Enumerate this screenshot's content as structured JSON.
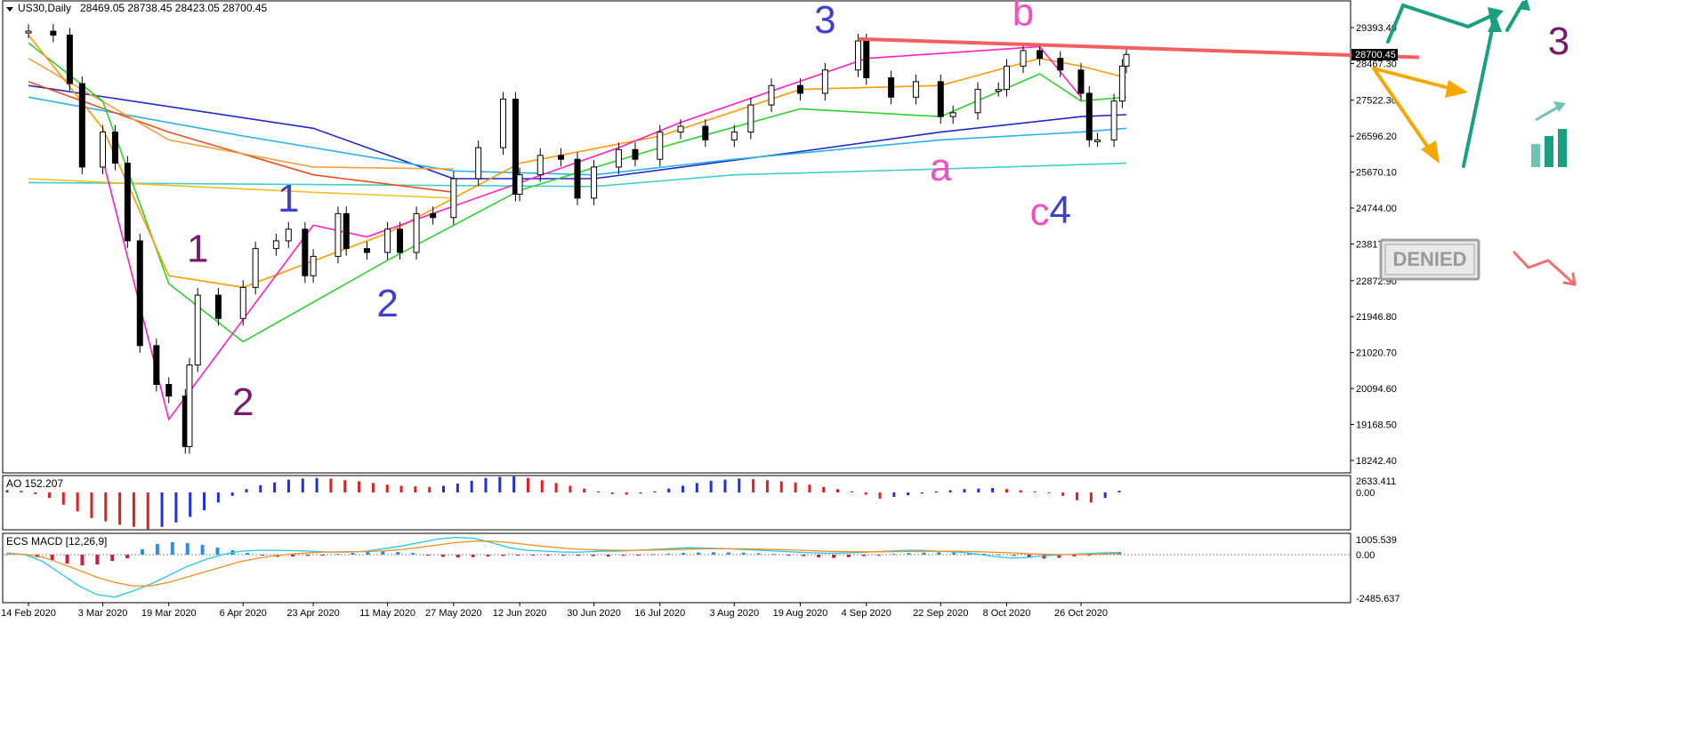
{
  "header": {
    "symbol": "US30,Daily",
    "ohlc": "28469.05 28738.45 28423.05 28700.45",
    "last_price": "28700.45"
  },
  "indicators": {
    "ao_label": "AO 152.207",
    "macd_label": "ECS MACD [12,26,9]"
  },
  "badge": {
    "text": "DENIED"
  },
  "chart_data": [
    {
      "type": "line",
      "panel": "price",
      "x_labels": [
        "14 Feb 2020",
        "3 Mar 2020",
        "19 Mar 2020",
        "6 Apr 2020",
        "23 Apr 2020",
        "11 May 2020",
        "27 May 2020",
        "12 Jun 2020",
        "30 Jun 2020",
        "16 Jul 2020",
        "3 Aug 2020",
        "19 Aug 2020",
        "4 Sep 2020",
        "22 Sep 2020",
        "8 Oct 2020",
        "26 Oct 2020"
      ],
      "y_ticks": [
        "29393.40",
        "28467.30",
        "27522.30",
        "26596.20",
        "25670.10",
        "24744.00",
        "23817.90",
        "22872.90",
        "21946.80",
        "21020.70",
        "20094.60",
        "19168.50",
        "18242.40"
      ],
      "ylim": [
        17900,
        29750
      ],
      "close_series": [
        {
          "date": "14 Feb 2020",
          "close": 29300
        },
        {
          "date": "20 Feb 2020",
          "close": 29200
        },
        {
          "date": "24 Feb 2020",
          "close": 27950
        },
        {
          "date": "27 Feb 2020",
          "close": 25800
        },
        {
          "date": "3 Mar 2020",
          "close": 26700
        },
        {
          "date": "6 Mar 2020",
          "close": 25900
        },
        {
          "date": "9 Mar 2020",
          "close": 23900
        },
        {
          "date": "12 Mar 2020",
          "close": 21200
        },
        {
          "date": "16 Mar 2020",
          "close": 20200
        },
        {
          "date": "19 Mar 2020",
          "close": 19900
        },
        {
          "date": "23 Mar 2020",
          "close": 18600
        },
        {
          "date": "24 Mar 2020",
          "close": 20700
        },
        {
          "date": "26 Mar 2020",
          "close": 22500
        },
        {
          "date": "31 Mar 2020",
          "close": 21900
        },
        {
          "date": "6 Apr 2020",
          "close": 22700
        },
        {
          "date": "9 Apr 2020",
          "close": 23700
        },
        {
          "date": "14 Apr 2020",
          "close": 23900
        },
        {
          "date": "17 Apr 2020",
          "close": 24200
        },
        {
          "date": "21 Apr 2020",
          "close": 23000
        },
        {
          "date": "23 Apr 2020",
          "close": 23500
        },
        {
          "date": "29 Apr 2020",
          "close": 24600
        },
        {
          "date": "1 May 2020",
          "close": 23700
        },
        {
          "date": "6 May 2020",
          "close": 23600
        },
        {
          "date": "11 May 2020",
          "close": 24200
        },
        {
          "date": "14 May 2020",
          "close": 23600
        },
        {
          "date": "18 May 2020",
          "close": 24600
        },
        {
          "date": "22 May 2020",
          "close": 24500
        },
        {
          "date": "27 May 2020",
          "close": 25500
        },
        {
          "date": "2 Jun 2020",
          "close": 26300
        },
        {
          "date": "8 Jun 2020",
          "close": 27550
        },
        {
          "date": "11 Jun 2020",
          "close": 25100
        },
        {
          "date": "12 Jun 2020",
          "close": 25600
        },
        {
          "date": "17 Jun 2020",
          "close": 26100
        },
        {
          "date": "22 Jun 2020",
          "close": 26000
        },
        {
          "date": "26 Jun 2020",
          "close": 25000
        },
        {
          "date": "30 Jun 2020",
          "close": 25800
        },
        {
          "date": "6 Jul 2020",
          "close": 26250
        },
        {
          "date": "10 Jul 2020",
          "close": 26000
        },
        {
          "date": "16 Jul 2020",
          "close": 26700
        },
        {
          "date": "21 Jul 2020",
          "close": 26850
        },
        {
          "date": "27 Jul 2020",
          "close": 26500
        },
        {
          "date": "3 Aug 2020",
          "close": 26700
        },
        {
          "date": "7 Aug 2020",
          "close": 27400
        },
        {
          "date": "12 Aug 2020",
          "close": 27900
        },
        {
          "date": "19 Aug 2020",
          "close": 27700
        },
        {
          "date": "25 Aug 2020",
          "close": 28300
        },
        {
          "date": "2 Sep 2020",
          "close": 29050
        },
        {
          "date": "4 Sep 2020",
          "close": 28100
        },
        {
          "date": "10 Sep 2020",
          "close": 27600
        },
        {
          "date": "16 Sep 2020",
          "close": 28000
        },
        {
          "date": "22 Sep 2020",
          "close": 27100
        },
        {
          "date": "25 Sep 2020",
          "close": 27200
        },
        {
          "date": "1 Oct 2020",
          "close": 27800
        },
        {
          "date": "6 Oct 2020",
          "close": 27800
        },
        {
          "date": "8 Oct 2020",
          "close": 28400
        },
        {
          "date": "12 Oct 2020",
          "close": 28800
        },
        {
          "date": "16 Oct 2020",
          "close": 28600
        },
        {
          "date": "21 Oct 2020",
          "close": 28300
        },
        {
          "date": "26 Oct 2020",
          "close": 27700
        },
        {
          "date": "28 Oct 2020",
          "close": 26500
        },
        {
          "date": "30 Oct 2020",
          "close": 26500
        },
        {
          "date": "3 Nov 2020",
          "close": 27500
        },
        {
          "date": "5 Nov 2020",
          "close": 28400
        },
        {
          "date": "6 Nov 2020",
          "close": 28700
        }
      ],
      "moving_averages": [
        {
          "color": "#2028c8",
          "points": [
            {
              "date": "14 Feb 2020",
              "value": 27900
            },
            {
              "date": "23 Apr 2020",
              "value": 26800
            },
            {
              "date": "27 May 2020",
              "value": 25500
            },
            {
              "date": "30 Jun 2020",
              "value": 25500
            },
            {
              "date": "19 Aug 2020",
              "value": 26200
            },
            {
              "date": "22 Sep 2020",
              "value": 26700
            },
            {
              "date": "26 Oct 2020",
              "value": 27100
            },
            {
              "date": "6 Nov 2020",
              "value": 27150
            }
          ]
        },
        {
          "color": "#28b4e8",
          "points": [
            {
              "date": "14 Feb 2020",
              "value": 27600
            },
            {
              "date": "6 Apr 2020",
              "value": 26600
            },
            {
              "date": "27 May 2020",
              "value": 25700
            },
            {
              "date": "30 Jun 2020",
              "value": 25600
            },
            {
              "date": "3 Aug 2020",
              "value": 26000
            },
            {
              "date": "22 Sep 2020",
              "value": 26500
            },
            {
              "date": "26 Oct 2020",
              "value": 26700
            },
            {
              "date": "6 Nov 2020",
              "value": 26800
            }
          ]
        },
        {
          "color": "#40d0c8",
          "points": [
            {
              "date": "14 Feb 2020",
              "value": 25400
            },
            {
              "date": "23 Apr 2020",
              "value": 25350
            },
            {
              "date": "30 Jun 2020",
              "value": 25300
            },
            {
              "date": "3 Aug 2020",
              "value": 25600
            },
            {
              "date": "22 Sep 2020",
              "value": 25750
            },
            {
              "date": "6 Nov 2020",
              "value": 25900
            }
          ]
        },
        {
          "color": "#e85020",
          "points": [
            {
              "date": "14 Feb 2020",
              "value": 28000
            },
            {
              "date": "19 Mar 2020",
              "value": 26700
            },
            {
              "date": "23 Apr 2020",
              "value": 25600
            },
            {
              "date": "27 May 2020",
              "value": 25150
            }
          ]
        },
        {
          "color": "#f0a040",
          "points": [
            {
              "date": "14 Feb 2020",
              "value": 28600
            },
            {
              "date": "19 Mar 2020",
              "value": 26500
            },
            {
              "date": "23 Apr 2020",
              "value": 25800
            },
            {
              "date": "27 May 2020",
              "value": 25750
            }
          ]
        },
        {
          "color": "#f0c020",
          "points": [
            {
              "date": "14 Feb 2020",
              "value": 25500
            },
            {
              "date": "23 Apr 2020",
              "value": 25150
            },
            {
              "date": "27 May 2020",
              "value": 25000
            }
          ]
        },
        {
          "color": "#30d030",
          "points": [
            {
              "date": "14 Feb 2020",
              "value": 29000
            },
            {
              "date": "3 Mar 2020",
              "value": 27500
            },
            {
              "date": "19 Mar 2020",
              "value": 22800
            },
            {
              "date": "6 Apr 2020",
              "value": 21300
            },
            {
              "date": "11 May 2020",
              "value": 23400
            },
            {
              "date": "12 Jun 2020",
              "value": 25200
            },
            {
              "date": "16 Jul 2020",
              "value": 26300
            },
            {
              "date": "19 Aug 2020",
              "value": 27300
            },
            {
              "date": "22 Sep 2020",
              "value": 27100
            },
            {
              "date": "16 Oct 2020",
              "value": 28200
            },
            {
              "date": "26 Oct 2020",
              "value": 27500
            },
            {
              "date": "6 Nov 2020",
              "value": 27600
            }
          ]
        },
        {
          "color": "#ff9a00",
          "points": [
            {
              "date": "14 Feb 2020",
              "value": 29200
            },
            {
              "date": "3 Mar 2020",
              "value": 26800
            },
            {
              "date": "19 Mar 2020",
              "value": 23000
            },
            {
              "date": "6 Apr 2020",
              "value": 22700
            },
            {
              "date": "11 May 2020",
              "value": 24100
            },
            {
              "date": "12 Jun 2020",
              "value": 25900
            },
            {
              "date": "16 Jul 2020",
              "value": 26600
            },
            {
              "date": "19 Aug 2020",
              "value": 27800
            },
            {
              "date": "22 Sep 2020",
              "value": 27900
            },
            {
              "date": "16 Oct 2020",
              "value": 28600
            },
            {
              "date": "26 Oct 2020",
              "value": 28400
            },
            {
              "date": "6 Nov 2020",
              "value": 28100
            }
          ]
        },
        {
          "color": "#ff20c0",
          "points": [
            {
              "date": "3 Mar 2020",
              "value": 26000
            },
            {
              "date": "19 Mar 2020",
              "value": 19300
            },
            {
              "date": "23 Apr 2020",
              "value": 24300
            },
            {
              "date": "6 May 2020",
              "value": 24000
            },
            {
              "date": "6 Jul 2020",
              "value": 26300
            },
            {
              "date": "21 Jul 2020",
              "value": 26950
            },
            {
              "date": "4 Sep 2020",
              "value": 28600
            },
            {
              "date": "16 Oct 2020",
              "value": 28900
            },
            {
              "date": "26 Oct 2020",
              "value": 27600
            }
          ]
        }
      ],
      "resistance_line": {
        "color": "#f06060",
        "from": {
          "date": "2 Sep 2020",
          "value": 29100
        },
        "to_value": 28900
      },
      "annotations": [
        {
          "text": "1",
          "color": "#7a1a6e",
          "date": "26 Mar 2020",
          "value": 23700
        },
        {
          "text": "2",
          "color": "#7a1a6e",
          "date": "6 Apr 2020",
          "value": 19750
        },
        {
          "text": "1",
          "color": "#4040d0",
          "date": "17 Apr 2020",
          "value": 25000
        },
        {
          "text": "2",
          "color": "#4040d0",
          "date": "11 May 2020",
          "value": 22300
        },
        {
          "text": "3",
          "color": "#4040d0",
          "date": "25 Aug 2020",
          "value": 29600
        },
        {
          "text": "a",
          "color": "#f050c0",
          "date": "22 Sep 2020",
          "value": 25800
        },
        {
          "text": "b",
          "color": "#f050c0",
          "date": "12 Oct 2020",
          "value": 29800
        },
        {
          "text": "c",
          "color": "#f050c0",
          "date": "16 Oct 2020",
          "value": 24650
        },
        {
          "text": "4",
          "color": "#4040d0",
          "date": "21 Oct 2020",
          "value": 24700
        },
        {
          "text": "3",
          "color": "#7a1a6e",
          "date": "future",
          "value": 29050
        }
      ]
    },
    {
      "type": "bar",
      "panel": "AO",
      "title": "AO 152.207",
      "y_ticks": [
        "2633.411",
        "0.00"
      ],
      "values": [
        200,
        150,
        -150,
        -500,
        -1100,
        -1700,
        -2300,
        -2600,
        -2900,
        -3100,
        -3300,
        -3100,
        -2700,
        -2200,
        -1600,
        -900,
        -300,
        300,
        650,
        900,
        1150,
        1250,
        1300,
        1250,
        1100,
        1000,
        850,
        700,
        600,
        550,
        500,
        600,
        800,
        1050,
        1300,
        1400,
        1450,
        1300,
        1100,
        850,
        600,
        350,
        100,
        -150,
        -200,
        -100,
        100,
        350,
        600,
        850,
        1050,
        1150,
        1250,
        1200,
        1100,
        1000,
        900,
        700,
        500,
        300,
        100,
        -200,
        -550,
        -400,
        -250,
        -100,
        100,
        200,
        300,
        350,
        400,
        300,
        200,
        100,
        -50,
        -300,
        -700,
        -900,
        -500,
        152
      ]
    },
    {
      "type": "bar",
      "panel": "MACD",
      "title": "ECS MACD [12,26,9]",
      "y_ticks": [
        "1005.539",
        "0.00",
        "-2485.637"
      ],
      "histogram": [
        30,
        40,
        -150,
        -300,
        -500,
        -600,
        -550,
        -350,
        -200,
        300,
        600,
        700,
        650,
        550,
        400,
        250,
        100,
        -50,
        -120,
        -100,
        -60,
        -20,
        40,
        100,
        150,
        180,
        150,
        100,
        -50,
        -120,
        -160,
        -140,
        -100,
        -70,
        -50,
        -30,
        -20,
        -40,
        -60,
        -80,
        -100,
        -60,
        -20,
        30,
        60,
        100,
        120,
        140,
        130,
        110,
        80,
        40,
        -20,
        -80,
        -150,
        -180,
        -140,
        -80,
        -20,
        40,
        90,
        120,
        140,
        120,
        90,
        50,
        10,
        -60,
        -150,
        -220,
        -180,
        -100,
        -40,
        120,
        152
      ],
      "macd": [
        100,
        0,
        -400,
        -1100,
        -1800,
        -2300,
        -2450,
        -2100,
        -1700,
        -1200,
        -700,
        -300,
        0,
        200,
        250,
        250,
        230,
        200,
        150,
        150,
        200,
        350,
        500,
        700,
        900,
        1000,
        950,
        700,
        400,
        250,
        200,
        150,
        150,
        200,
        200,
        250,
        300,
        350,
        400,
        380,
        350,
        300,
        250,
        200,
        150,
        100,
        80,
        100,
        150,
        200,
        250,
        250,
        200,
        150,
        50,
        -100,
        -200,
        -150,
        -50,
        0,
        50,
        100,
        120
      ],
      "signal": [
        50,
        20,
        -150,
        -500,
        -900,
        -1300,
        -1600,
        -1800,
        -1800,
        -1600,
        -1300,
        -1000,
        -700,
        -400,
        -200,
        -50,
        50,
        120,
        160,
        170,
        180,
        220,
        300,
        420,
        560,
        700,
        780,
        780,
        700,
        580,
        470,
        380,
        310,
        270,
        250,
        250,
        265,
        290,
        320,
        340,
        345,
        340,
        320,
        290,
        260,
        220,
        190,
        170,
        165,
        170,
        180,
        195,
        200,
        195,
        175,
        140,
        100,
        50,
        20,
        5,
        10,
        30,
        60
      ]
    }
  ]
}
